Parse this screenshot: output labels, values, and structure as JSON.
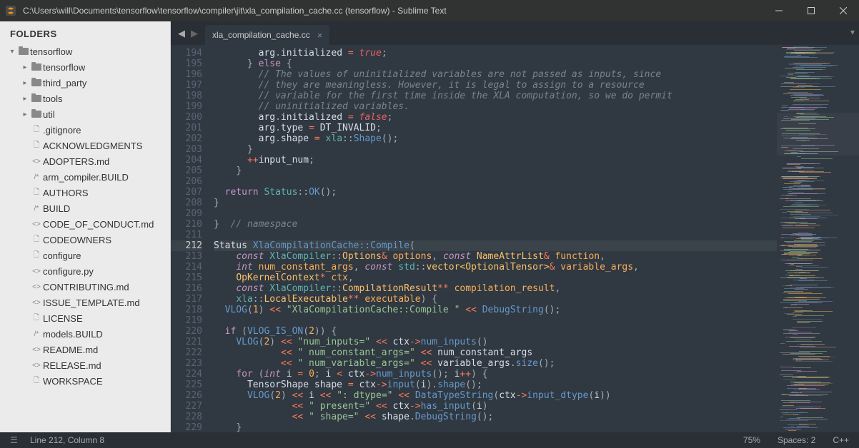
{
  "window": {
    "title": "C:\\Users\\will\\Documents\\tensorflow\\tensorflow\\compiler\\jit\\xla_compilation_cache.cc (tensorflow) - Sublime Text"
  },
  "sidebar": {
    "header": "FOLDERS",
    "root": {
      "label": "tensorflow",
      "expanded": true
    },
    "folders": [
      {
        "label": "tensorflow"
      },
      {
        "label": "third_party"
      },
      {
        "label": "tools"
      },
      {
        "label": "util"
      }
    ],
    "files": [
      {
        "icon": "txt",
        "label": ".gitignore"
      },
      {
        "icon": "txt",
        "label": "ACKNOWLEDGMENTS"
      },
      {
        "icon": "md",
        "label": "ADOPTERS.md"
      },
      {
        "icon": "cfg",
        "label": "arm_compiler.BUILD"
      },
      {
        "icon": "txt",
        "label": "AUTHORS"
      },
      {
        "icon": "cfg",
        "label": "BUILD"
      },
      {
        "icon": "md",
        "label": "CODE_OF_CONDUCT.md"
      },
      {
        "icon": "txt",
        "label": "CODEOWNERS"
      },
      {
        "icon": "txt",
        "label": "configure"
      },
      {
        "icon": "md",
        "label": "configure.py"
      },
      {
        "icon": "md",
        "label": "CONTRIBUTING.md"
      },
      {
        "icon": "md",
        "label": "ISSUE_TEMPLATE.md"
      },
      {
        "icon": "txt",
        "label": "LICENSE"
      },
      {
        "icon": "cfg",
        "label": "models.BUILD"
      },
      {
        "icon": "md",
        "label": "README.md"
      },
      {
        "icon": "md",
        "label": "RELEASE.md"
      },
      {
        "icon": "txt",
        "label": "WORKSPACE"
      }
    ]
  },
  "tab": {
    "label": "xla_compilation_cache.cc"
  },
  "gutter": {
    "start": 194,
    "end": 229,
    "highlight": 212
  },
  "code": {
    "lines": [
      "        arg<span class='punc'>.</span><span class='var'>initialized</span> <span class='op'>=</span> <span class='bool'>true</span><span class='punc'>;</span>",
      "      <span class='punc'>}</span> <span class='kw2'>else</span> <span class='punc'>{</span>",
      "        <span class='cmt'>// The values of uninitialized variables are not passed as inputs, since</span>",
      "        <span class='cmt'>// they are meaningless. However, it is legal to assign to a resource</span>",
      "        <span class='cmt'>// variable for the first time inside the XLA computation, so we do permit</span>",
      "        <span class='cmt'>// uninitialized variables.</span>",
      "        arg<span class='punc'>.</span><span class='var'>initialized</span> <span class='op'>=</span> <span class='bool'>false</span><span class='punc'>;</span>",
      "        arg<span class='punc'>.</span><span class='var'>type</span> <span class='op'>=</span> DT_INVALID<span class='punc'>;</span>",
      "        arg<span class='punc'>.</span><span class='var'>shape</span> <span class='op'>=</span> <span class='fn2'>xla</span><span class='punc'>::</span><span class='fn'>Shape</span><span class='punc'>();</span>",
      "      <span class='punc'>}</span>",
      "      <span class='op'>++</span>input_num<span class='punc'>;</span>",
      "    <span class='punc'>}</span>",
      "",
      "  <span class='kw2'>return</span> <span class='fn2'>Status</span><span class='punc'>::</span><span class='fn'>OK</span><span class='punc'>();</span>",
      "<span class='punc'>}</span>",
      "",
      "<span class='punc'>}</span>  <span class='cmt'>// namespace</span>",
      "",
      "Status <span class='fn'>XlaCompilationCache::Compile</span><span class='punc'>(</span>",
      "    <span class='typ'>const</span> <span class='fn2'>XlaCompiler</span><span class='punc'>::</span><span class='cls'>Options</span><span class='op'>&amp;</span> <span class='prm'>options</span><span class='punc'>,</span> <span class='typ'>const</span> <span class='cls'>NameAttrList</span><span class='op'>&amp;</span> <span class='prm'>function</span><span class='punc'>,</span>",
      "    <span class='typ'>int</span> <span class='prm'>num_constant_args</span><span class='punc'>,</span> <span class='typ'>const</span> <span class='fn2'>std</span><span class='punc'>::</span><span class='cls'>vector&lt;OptionalTensor&gt;</span><span class='op'>&amp;</span> <span class='prm'>variable_args</span><span class='punc'>,</span>",
      "    <span class='cls'>OpKernelContext</span><span class='op'>*</span> <span class='prm'>ctx</span><span class='punc'>,</span>",
      "    <span class='typ'>const</span> <span class='fn2'>XlaCompiler</span><span class='punc'>::</span><span class='cls'>CompilationResult</span><span class='op'>**</span> <span class='prm'>compilation_result</span><span class='punc'>,</span>",
      "    <span class='fn2'>xla</span><span class='punc'>::</span><span class='cls'>LocalExecutable</span><span class='op'>**</span> <span class='prm'>executable</span><span class='punc'>) {</span>",
      "  <span class='fn'>VLOG</span><span class='punc'>(</span><span class='num'>1</span><span class='punc'>)</span> <span class='op'>&lt;&lt;</span> <span class='str'>\"XlaCompilationCache::Compile \"</span> <span class='op'>&lt;&lt;</span> <span class='fn'>DebugString</span><span class='punc'>();</span>",
      "",
      "  <span class='kw2'>if</span> <span class='punc'>(</span><span class='fn'>VLOG_IS_ON</span><span class='punc'>(</span><span class='num'>2</span><span class='punc'>)) {</span>",
      "    <span class='fn'>VLOG</span><span class='punc'>(</span><span class='num'>2</span><span class='punc'>)</span> <span class='op'>&lt;&lt;</span> <span class='str'>\"num_inputs=\"</span> <span class='op'>&lt;&lt;</span> ctx<span class='op'>-&gt;</span><span class='fn'>num_inputs</span><span class='punc'>()</span>",
      "            <span class='op'>&lt;&lt;</span> <span class='str'>\" num_constant_args=\"</span> <span class='op'>&lt;&lt;</span> num_constant_args",
      "            <span class='op'>&lt;&lt;</span> <span class='str'>\" num_variable_args=\"</span> <span class='op'>&lt;&lt;</span> variable_args<span class='punc'>.</span><span class='fn'>size</span><span class='punc'>();</span>",
      "    <span class='kw2'>for</span> <span class='punc'>(</span><span class='typ'>int</span> i <span class='op'>=</span> <span class='num'>0</span><span class='punc'>;</span> i <span class='op'>&lt;</span> ctx<span class='op'>-&gt;</span><span class='fn'>num_inputs</span><span class='punc'>();</span> i<span class='op'>++</span><span class='punc'>) {</span>",
      "      TensorShape shape <span class='op'>=</span> ctx<span class='op'>-&gt;</span><span class='fn'>input</span><span class='punc'>(</span>i<span class='punc'>).</span><span class='fn'>shape</span><span class='punc'>();</span>",
      "      <span class='fn'>VLOG</span><span class='punc'>(</span><span class='num'>2</span><span class='punc'>)</span> <span class='op'>&lt;&lt;</span> i <span class='op'>&lt;&lt;</span> <span class='str'>\": dtype=\"</span> <span class='op'>&lt;&lt;</span> <span class='fn'>DataTypeString</span><span class='punc'>(</span>ctx<span class='op'>-&gt;</span><span class='fn'>input_dtype</span><span class='punc'>(</span>i<span class='punc'>))</span>",
      "              <span class='op'>&lt;&lt;</span> <span class='str'>\" present=\"</span> <span class='op'>&lt;&lt;</span> ctx<span class='op'>-&gt;</span><span class='fn'>has_input</span><span class='punc'>(</span>i<span class='punc'>)</span>",
      "              <span class='op'>&lt;&lt;</span> <span class='str'>\" shape=\"</span> <span class='op'>&lt;&lt;</span> shape<span class='punc'>.</span><span class='fn'>DebugString</span><span class='punc'>();</span>",
      "    <span class='punc'>}</span>"
    ]
  },
  "status": {
    "cursor": "Line 212, Column 8",
    "zoom": "75%",
    "spaces": "Spaces: 2",
    "lang": "C++"
  }
}
